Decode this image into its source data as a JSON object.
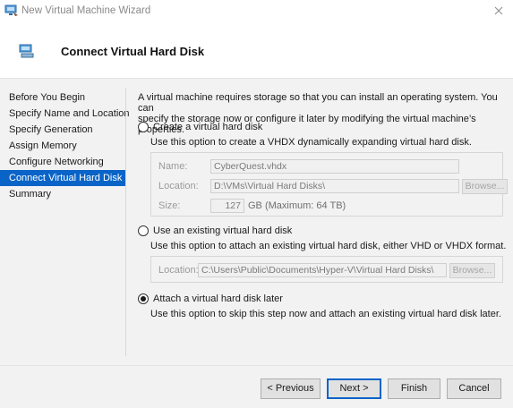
{
  "window": {
    "title": "New Virtual Machine Wizard",
    "icon": "vm-wizard-icon",
    "close_icon": "close-icon"
  },
  "header": {
    "title": "Connect Virtual Hard Disk",
    "icon": "hard-disk-icon"
  },
  "nav": {
    "items": [
      {
        "label": "Before You Begin",
        "active": false
      },
      {
        "label": "Specify Name and Location",
        "active": false
      },
      {
        "label": "Specify Generation",
        "active": false
      },
      {
        "label": "Assign Memory",
        "active": false
      },
      {
        "label": "Configure Networking",
        "active": false
      },
      {
        "label": "Connect Virtual Hard Disk",
        "active": true
      },
      {
        "label": "Summary",
        "active": false
      }
    ]
  },
  "content": {
    "intro_line1": "A virtual machine requires storage so that you can install an operating system. You can",
    "intro_line2": "specify the storage now or configure it later by modifying the virtual machine’s properties.",
    "option_create": {
      "label": "Create a virtual hard disk",
      "description": "Use this option to create a VHDX dynamically expanding virtual hard disk.",
      "selected": false,
      "name_label": "Name:",
      "name_value": "CyberQuest.vhdx",
      "location_label": "Location:",
      "location_value": "D:\\VMs\\Virtual Hard Disks\\",
      "browse_label": "Browse...",
      "size_label": "Size:",
      "size_value": "127",
      "size_unit": "GB (Maximum: 64 TB)"
    },
    "option_existing": {
      "label": "Use an existing virtual hard disk",
      "description": "Use this option to attach an existing virtual hard disk, either VHD or VHDX format.",
      "selected": false,
      "location_label": "Location:",
      "location_value": "C:\\Users\\Public\\Documents\\Hyper-V\\Virtual Hard Disks\\",
      "browse_label": "Browse..."
    },
    "option_later": {
      "label": "Attach a virtual hard disk later",
      "description": "Use this option to skip this step now and attach an existing virtual hard disk later.",
      "selected": true
    }
  },
  "footer": {
    "previous_label": "< Previous",
    "next_label": "Next >",
    "finish_label": "Finish",
    "cancel_label": "Cancel"
  },
  "colors": {
    "accent": "#0a64c8",
    "panel_bg": "#f2f2f2"
  }
}
